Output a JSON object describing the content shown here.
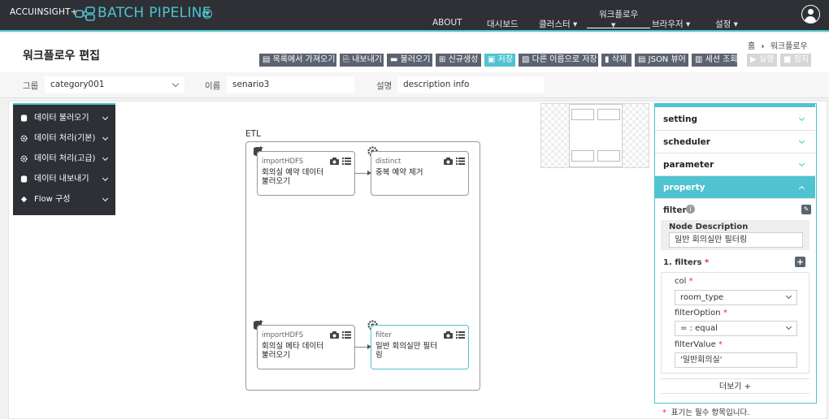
{
  "header": {
    "vendor": "ACCUINSIGHT+",
    "product": "BATCH PIPELINE",
    "nav": [
      {
        "label": "ABOUT"
      },
      {
        "label": "대시보드"
      },
      {
        "label": "클러스터 ▾"
      },
      {
        "label": "워크플로우"
      },
      {
        "label": "브라우저 ▾"
      },
      {
        "label": "설정 ▾"
      }
    ]
  },
  "page": {
    "title": "워크플로우 편집",
    "breadcrumb_home": "홈",
    "breadcrumb_sep": "›",
    "breadcrumb_current": "워크플로우"
  },
  "toolbar": [
    {
      "label": "목록에서 가져오기",
      "icon": "list-icon"
    },
    {
      "label": "내보내기",
      "icon": "export-icon"
    },
    {
      "label": "불러오기",
      "icon": "folder-icon"
    },
    {
      "label": "신규생성",
      "icon": "plus-icon"
    },
    {
      "label": "저장",
      "icon": "save-icon"
    },
    {
      "label": "다른 이름으로 저장",
      "icon": "copy-icon"
    },
    {
      "label": "삭제",
      "icon": "trash-icon"
    },
    {
      "label": "JSON 뷰어",
      "icon": "json-icon"
    },
    {
      "label": "세션 조회",
      "icon": "chart-icon"
    },
    {
      "label": "실행",
      "icon": "play-icon"
    },
    {
      "label": "정지",
      "icon": "stop-icon"
    }
  ],
  "filters": {
    "group_label": "그룹",
    "group_value": "category001",
    "name_label": "이름",
    "name_value": "senario3",
    "desc_label": "설명",
    "desc_value": "description info"
  },
  "palette": [
    {
      "label": "데이터 불러오기",
      "icon": "database-icon"
    },
    {
      "label": "데이터 처리(기본)",
      "icon": "gear-icon"
    },
    {
      "label": "데이터 처리(고급)",
      "icon": "gear-icon"
    },
    {
      "label": "데이터 내보내기",
      "icon": "database-icon"
    },
    {
      "label": "Flow 구성",
      "icon": "flow-icon"
    }
  ],
  "flow": {
    "group_label": "ETL",
    "nodes": [
      {
        "type": "importHDFS",
        "desc": "회의실 예약 데이터 불러오기",
        "icon": "database-icon"
      },
      {
        "type": "distinct",
        "desc": "중복 예약 제거",
        "icon": "gear-icon"
      },
      {
        "type": "importHDFS",
        "desc": "회의실 메타 데이터 불러오기",
        "icon": "database-icon"
      },
      {
        "type": "filter",
        "desc": "일반 회의실만 필터링",
        "icon": "gear-icon"
      }
    ]
  },
  "panel": {
    "sections": [
      "setting",
      "scheduler",
      "parameter",
      "property"
    ],
    "filter_title": "filter",
    "node_desc_label": "Node Description",
    "node_desc_value": "일반 회의실만 필터링",
    "filters_label": "1. filters",
    "col_label": "col",
    "col_value": "room_type",
    "filter_option_label": "filterOption",
    "filter_option_value": "= : equal",
    "filter_value_label": "filterValue",
    "filter_value_value": "'일반회의실'",
    "more_label": "더보기 +",
    "required_mark": "*",
    "required_note": "표기는 필수 항목입니다."
  },
  "colors": {
    "accent": "#4fc3cf",
    "header_bg": "#2e3036",
    "button_bg": "#5b6270"
  }
}
